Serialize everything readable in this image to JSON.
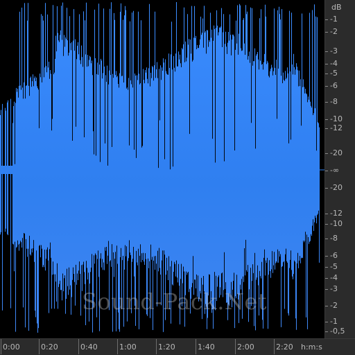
{
  "waveform": {
    "color_top": "#3b8cff",
    "color_mid": "#2f7ff0",
    "color_bottom": "#3f86f2",
    "background": "#000000",
    "progress_end_fraction": 0.985
  },
  "db_ruler": {
    "unit": "dB",
    "labels": [
      "-1",
      "-2",
      "-3",
      "-4",
      "-5",
      "-6",
      "-8",
      "-10",
      "-12",
      "-20",
      "-∞",
      "-20",
      "-12",
      "-10",
      "-8",
      "-6",
      "-5",
      "-4",
      "-3",
      "-2",
      "-1",
      "-0,5"
    ]
  },
  "time_ruler": {
    "unit": "h:m:s",
    "labels": [
      "0:00",
      "0:20",
      "0:40",
      "1:00",
      "1:20",
      "1:40",
      "2:00",
      "2:20"
    ]
  },
  "watermark": {
    "text": "Sound-Pack.Net"
  }
}
